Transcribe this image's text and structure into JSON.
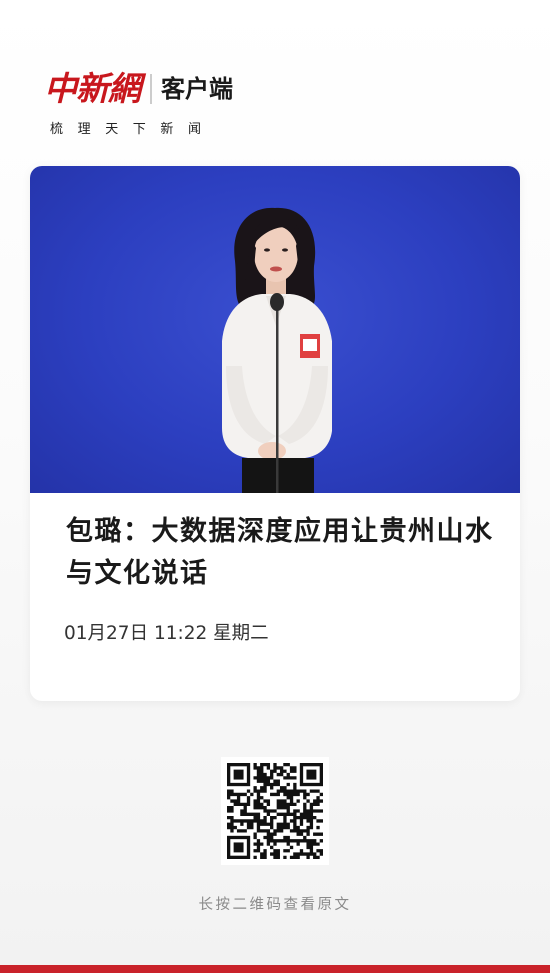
{
  "header": {
    "brand_logo": "中新網",
    "brand_sub": "客户端",
    "slogan": "梳理天下新闻"
  },
  "article": {
    "title": "包璐：大数据深度应用让贵州山水与文化说话",
    "datetime": "01月27日 11:22 星期二"
  },
  "qr": {
    "hint": "长按二维码查看原文"
  },
  "colors": {
    "brand_red": "#c8171d",
    "photo_backdrop_blue": "#2c3fc0",
    "bottom_bar": "#c9222a"
  }
}
